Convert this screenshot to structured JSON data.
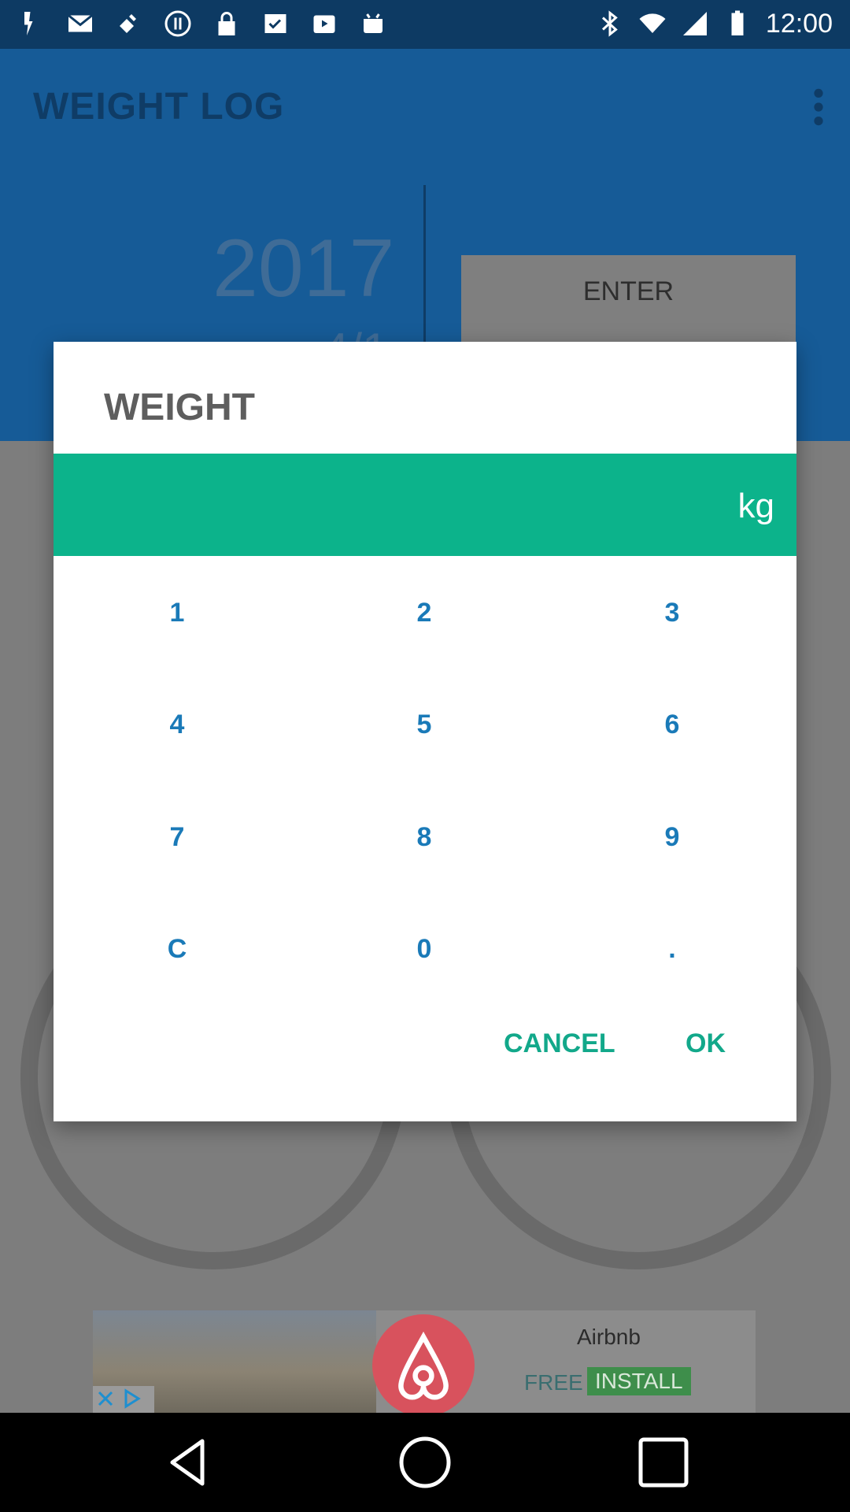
{
  "status_bar": {
    "time": "12:00",
    "left_icons": [
      "location-arrow-icon",
      "mail-icon",
      "satellite-icon",
      "pause-circle-icon",
      "lock-icon",
      "checklist-icon",
      "play-store-icon",
      "android-icon"
    ],
    "right_icons": [
      "bluetooth-icon",
      "wifi-icon",
      "signal-icon",
      "battery-icon"
    ]
  },
  "app": {
    "title": "WEIGHT LOG",
    "year": "2017",
    "date_partial": "4/1",
    "enter_label": "ENTER"
  },
  "dialog": {
    "title": "WEIGHT",
    "value": "",
    "unit": "kg",
    "keys": [
      "1",
      "2",
      "3",
      "4",
      "5",
      "6",
      "7",
      "8",
      "9",
      "C",
      "0",
      "."
    ],
    "cancel_label": "CANCEL",
    "ok_label": "OK"
  },
  "ad": {
    "name": "Airbnb",
    "free_label": "FREE",
    "install_label": "INSTALL"
  },
  "colors": {
    "accent": "#0cb38b",
    "key_text": "#1a7ab8",
    "button_text": "#12a88a",
    "header_bg": "#165b97"
  }
}
